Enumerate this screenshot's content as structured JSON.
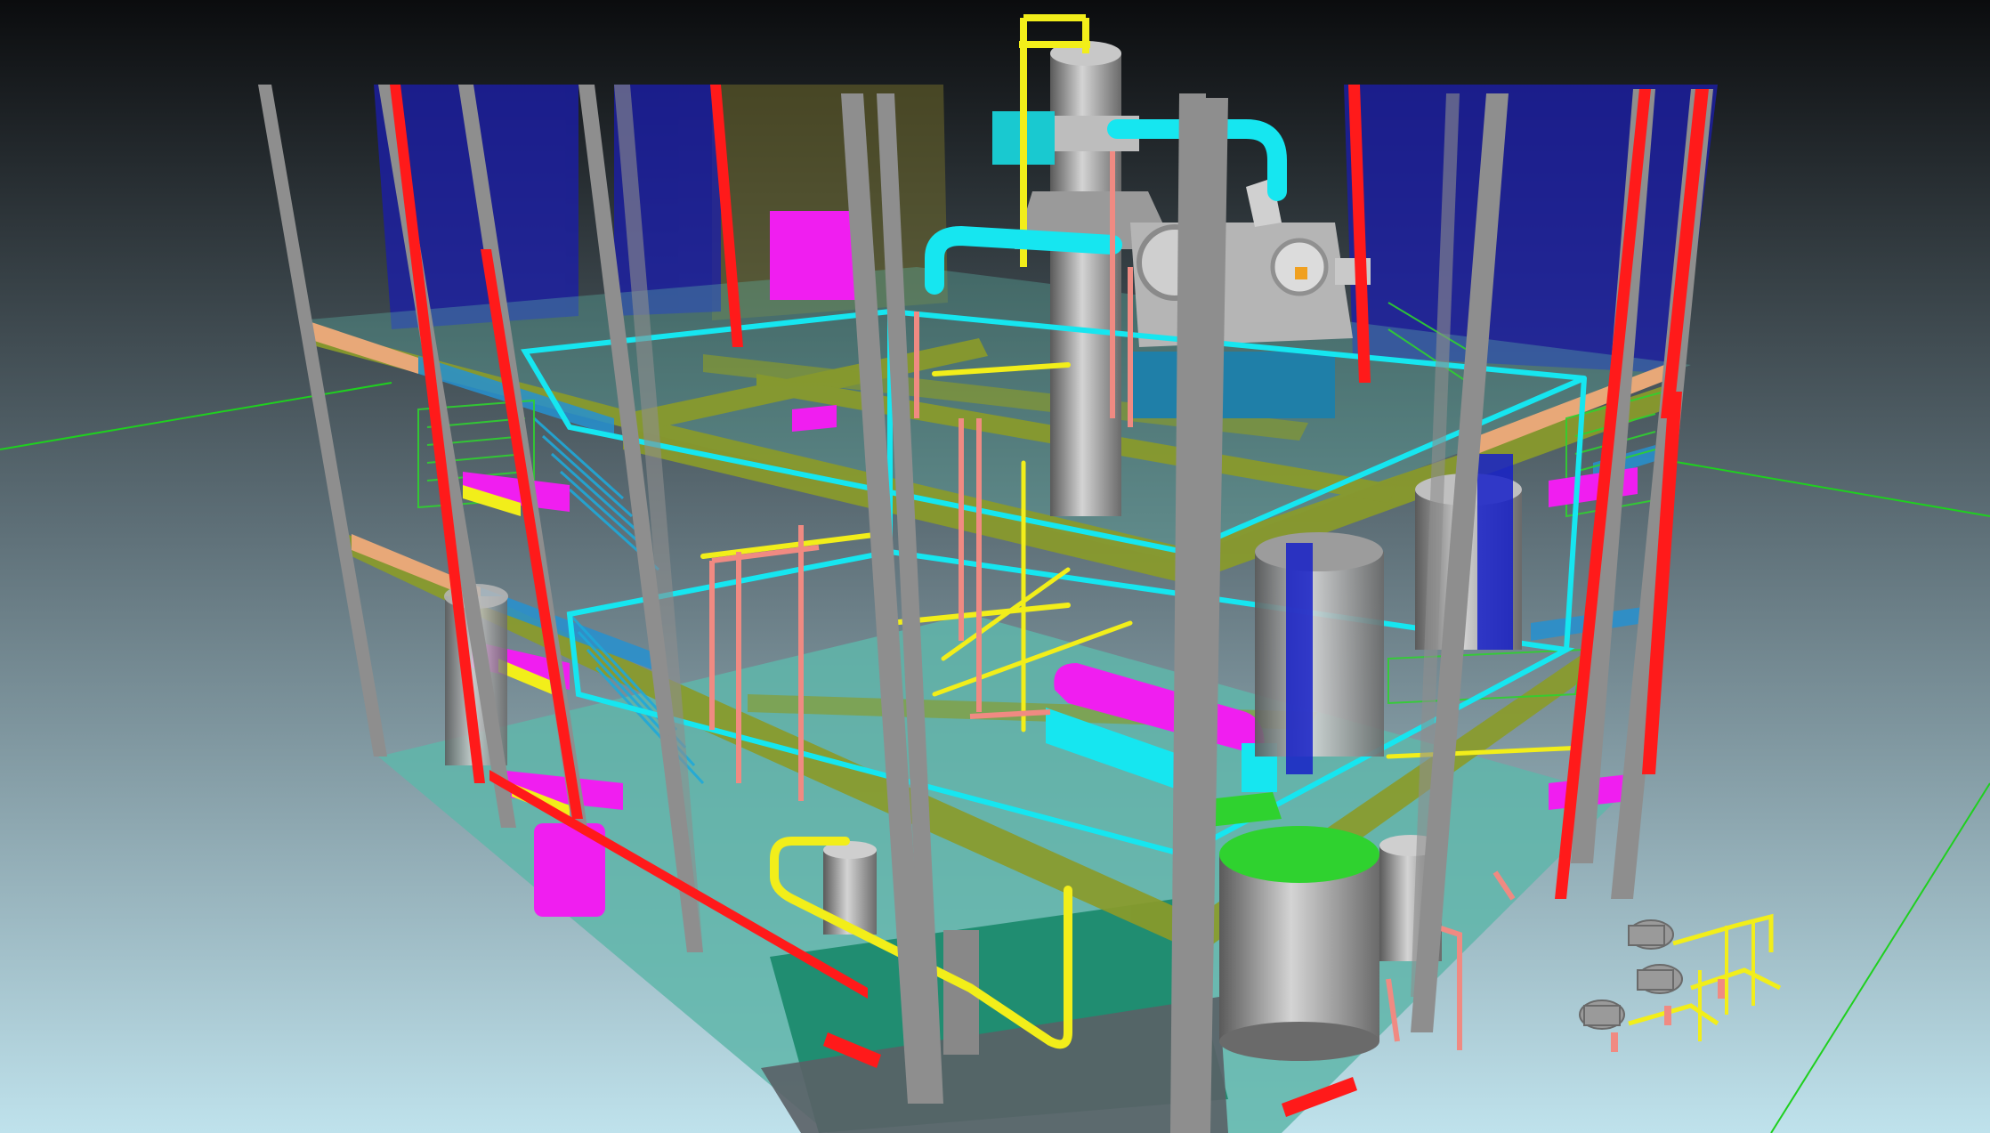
{
  "viewport": {
    "background_top": "#0b0c0e",
    "background_mid": "#5b6c74",
    "background_bottom": "#bfe2ec"
  },
  "model": {
    "colors": {
      "steel_column": "#8e8e8e",
      "steel_column_dark": "#6e6e6e",
      "red_bracing": "#ff1a1a",
      "blue_panel": "#1b1ea6",
      "olive_beam": "#8a9b2a",
      "olive_wall": "#6f6a2a",
      "cyan_pipe": "#16e6f0",
      "yellow_pipe": "#f2ee1a",
      "salmon_pipe": "#f08a82",
      "green_handrail": "#2fd22f",
      "magenta_equipment": "#f01ef0",
      "vessel_grey": "#a8a8a8",
      "floor_teal": "#5fb6aa",
      "floor_green": "#1c8a6e",
      "orange_beam": "#e8a878",
      "ground_axis": "#1fd01f"
    },
    "icons": [
      "distillation-column-icon",
      "centrifuge-icon",
      "storage-tank-icon",
      "pump-skid-icon",
      "staircase-icon"
    ]
  }
}
